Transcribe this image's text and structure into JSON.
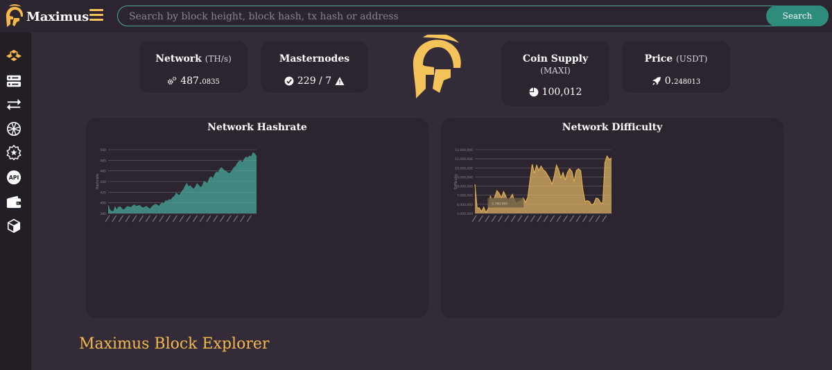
{
  "brand": {
    "name": "Maximus",
    "logo": "spartan-helmet"
  },
  "search": {
    "placeholder": "Search by block height, block hash, tx hash or address",
    "button_label": "Search"
  },
  "sidebar": {
    "items": [
      {
        "icon": "blocks-icon"
      },
      {
        "icon": "server-icon"
      },
      {
        "icon": "transactions-icon"
      },
      {
        "icon": "network-icon"
      },
      {
        "icon": "badge-icon"
      },
      {
        "icon": "api-icon"
      },
      {
        "icon": "wallet-icon"
      },
      {
        "icon": "cube-icon"
      }
    ]
  },
  "stats": {
    "network": {
      "title": "Network",
      "unit": "(TH/s)",
      "value_main": "487.",
      "value_small": "0835"
    },
    "masternodes": {
      "title": "Masternodes",
      "value": "229 / 7"
    },
    "coin_supply": {
      "title": "Coin Supply",
      "unit": "(MAXI)",
      "value": "100,012"
    },
    "price": {
      "title": "Price",
      "unit": "(USDT)",
      "value_main": "0.",
      "value_small": "248013"
    }
  },
  "colors": {
    "accent": "#f4b94a",
    "teal": "#2e8c7c",
    "hashrate_fill": "#4aa89a",
    "difficulty_fill": "#d9b163"
  },
  "chart_data": [
    {
      "type": "area",
      "title": "Network Hashrate",
      "ylabel": "Hashrate",
      "ylim": [
        380,
        500
      ],
      "yticks": [
        380,
        400,
        420,
        440,
        460,
        480,
        500
      ],
      "values": [
        395,
        386,
        384,
        383,
        392,
        386,
        392,
        392,
        388,
        386,
        390,
        393,
        392,
        391,
        394,
        396,
        393,
        394,
        395,
        392,
        390,
        392,
        393,
        390,
        388,
        392,
        395,
        397,
        396,
        393,
        397,
        400,
        398,
        404,
        403,
        406,
        405,
        410,
        412,
        418,
        415,
        414,
        420,
        424,
        430,
        436,
        430,
        432,
        428,
        425,
        430,
        436,
        432,
        428,
        432,
        440,
        438,
        436,
        446,
        449,
        445,
        452,
        458,
        456,
        463,
        466,
        462,
        460,
        458,
        455,
        456,
        460,
        466,
        468,
        474,
        478,
        479,
        475,
        482,
        486,
        484,
        488,
        486,
        494,
        492,
        486
      ]
    },
    {
      "type": "area",
      "title": "Network Difficulty",
      "ylabel": "Difficulty",
      "ylim": [
        5000000,
        12000000
      ],
      "yticks": [
        5000000,
        6000000,
        7000000,
        8000000,
        9000000,
        10000000,
        11000000,
        12000000
      ],
      "values": [
        8200000,
        5600000,
        5600000,
        5200000,
        5700000,
        5100000,
        5500000,
        6900000,
        6400000,
        6800000,
        7500000,
        7200000,
        6700000,
        7400000,
        6900000,
        6300000,
        6700000,
        7100000,
        6400000,
        6100000,
        6300000,
        6400000,
        6700000,
        6200000,
        6800000,
        8700000,
        10400000,
        9400000,
        10300000,
        9700000,
        10200000,
        9800000,
        9600000,
        9200000,
        8800000,
        8200000,
        9100000,
        10300000,
        9800000,
        8900000,
        9500000,
        8700000,
        9500000,
        9900000,
        9600000,
        8500000,
        9700000,
        9900000,
        9700000,
        7600000,
        6300000,
        6400000,
        6300000,
        5900000,
        6100000,
        6700000,
        6600000,
        6200000,
        6100000,
        10600000,
        11300000,
        10900000,
        11100000
      ],
      "annotation": "5.780,060"
    }
  ],
  "footer": {
    "title": "Maximus Block Explorer"
  }
}
